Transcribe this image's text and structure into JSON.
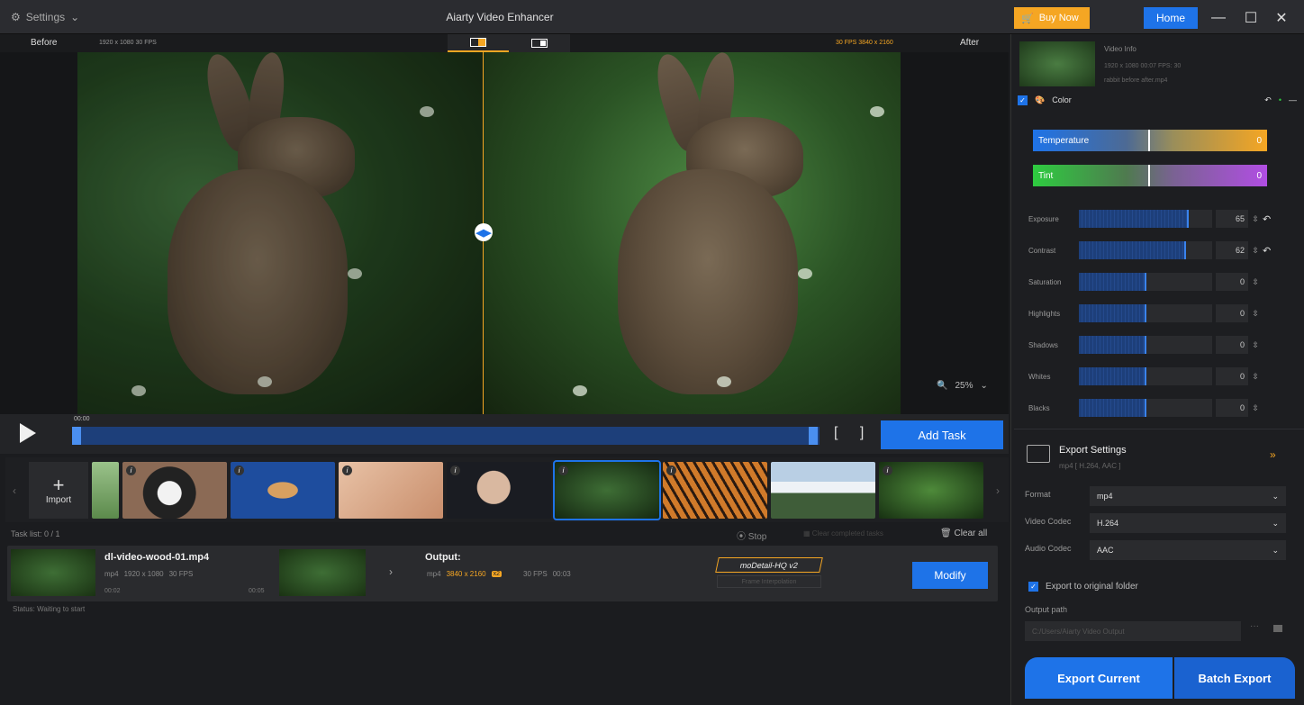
{
  "titlebar": {
    "settings_label": "Settings",
    "title": "Aiarty Video Enhancer",
    "buy_now": "Buy Now",
    "home": "Home"
  },
  "preview": {
    "before_label": "Before",
    "before_meta": "1920 x 1080  30 FPS",
    "after_label": "After",
    "after_meta": "30 FPS  3840 x 2160",
    "zoom": "25%"
  },
  "timeline": {
    "time": "00:00",
    "add_task": "Add Task",
    "brackets": "[ ]"
  },
  "thumbs": {
    "import_label": "Import"
  },
  "tasklist": {
    "label": "Task list:  0 / 1",
    "stop": "Stop",
    "clear_completed": "Clear completed tasks",
    "clear_all": "Clear all"
  },
  "task": {
    "filename": "dl-video-wood-01.mp4",
    "in_format": "mp4",
    "in_res": "1920 x 1080",
    "in_fps": "30 FPS",
    "start": "00:02",
    "end": "00:05",
    "output_label": "Output:",
    "out_format": "mp4",
    "out_res": "3840 x 2160",
    "out_scale": "x2",
    "out_fps": "30 FPS",
    "out_dur": "00:03",
    "model": "moDetail-HQ  v2",
    "model2": "Frame Interpolation",
    "modify": "Modify",
    "status": "Status: Waiting to start"
  },
  "right": {
    "video_info_title": "Video Info",
    "video_info_meta": "1920 x 1080  00:07  FPS: 30",
    "video_info_file": "rabbit before after.mp4",
    "color_label": "Color",
    "temperature": {
      "label": "Temperature",
      "value": "0"
    },
    "tint": {
      "label": "Tint",
      "value": "0"
    },
    "sliders": [
      {
        "label": "Exposure",
        "value": "65",
        "fill": 0.82
      },
      {
        "label": "Contrast",
        "value": "62",
        "fill": 0.8
      },
      {
        "label": "Saturation",
        "value": "0",
        "fill": 0.5
      },
      {
        "label": "Highlights",
        "value": "0",
        "fill": 0.5
      },
      {
        "label": "Shadows",
        "value": "0",
        "fill": 0.5
      },
      {
        "label": "Whites",
        "value": "0",
        "fill": 0.5
      },
      {
        "label": "Blacks",
        "value": "0",
        "fill": 0.5
      }
    ],
    "export_title": "Export Settings",
    "export_sub": "mp4 [ H.264, AAC ]",
    "format_label": "Format",
    "format_value": "mp4",
    "vcodec_label": "Video Codec",
    "vcodec_value": "H.264",
    "acodec_label": "Audio Codec",
    "acodec_value": "AAC",
    "orig_folder": "Export to original folder",
    "output_path_label": "Output path",
    "output_path_value": "C:/Users/Aiarty Video Output",
    "export_current": "Export Current",
    "batch_export": "Batch Export"
  },
  "colors": {
    "accent": "#1e73e8",
    "orange": "#f5a623"
  }
}
